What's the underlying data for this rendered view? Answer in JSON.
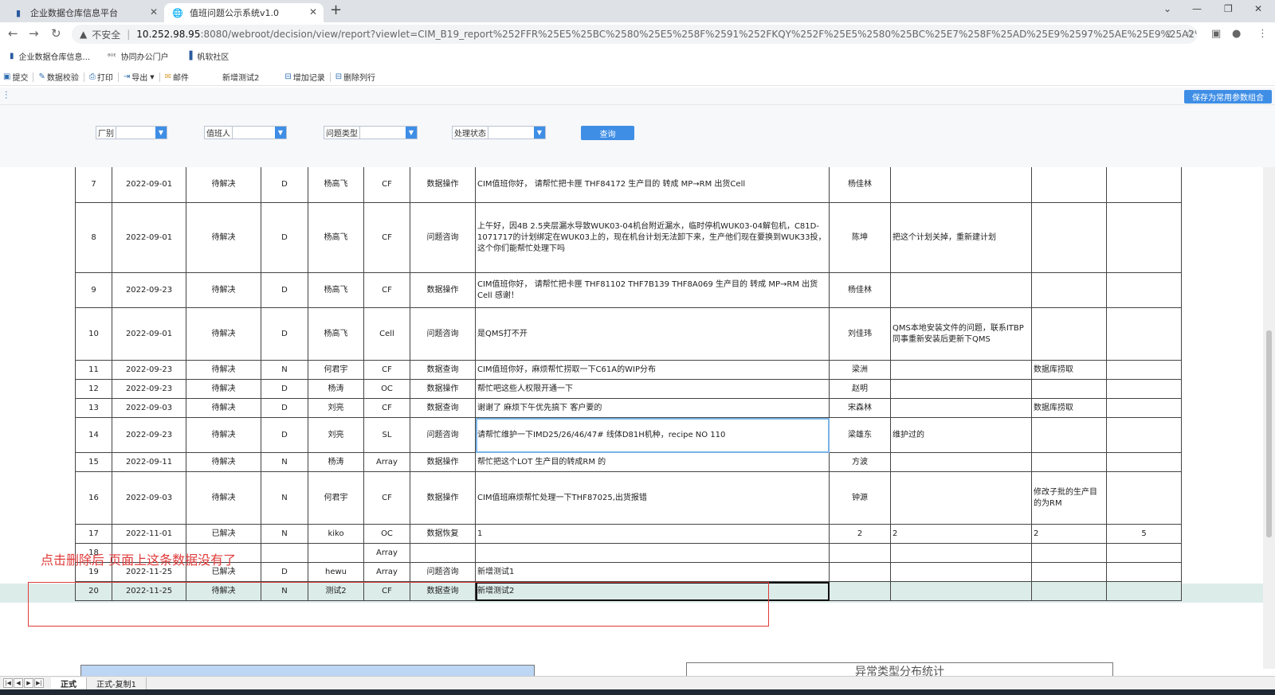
{
  "browser": {
    "tabs": [
      {
        "title": "企业数据仓库信息平台",
        "active": false
      },
      {
        "title": "值班问题公示系统v1.0",
        "active": true
      }
    ],
    "new_tab": "+",
    "address": {
      "security_label": "不安全",
      "host": "10.252.98.95",
      "path": ":8080/webroot/decision/view/report?viewlet=CIM_B19_report%252FFR%25E5%25BC%2580%25E5%258F%2591%252FKQY%252F%25E5%2580%25BC%25E7%258F%25AD%25E9%2597%25AE%25E9%25A2%2598%25..."
    },
    "bookmarks": [
      "企业数据仓库信息...",
      "协同办公门户",
      "帆软社区"
    ]
  },
  "toolbar": {
    "submit": "提交",
    "validate": "数据校验",
    "print": "打印",
    "export": "导出",
    "mail": "邮件",
    "new_test": "新增测试2",
    "add_record": "增加记录",
    "delete_row": "删除列行"
  },
  "params": {
    "save_label": "保存为常用参数组合",
    "factory_label": "厂别",
    "duty_label": "值班人",
    "type_label": "问题类型",
    "status_label": "处理状态",
    "query_label": "查询"
  },
  "rows": [
    {
      "no": "7",
      "date": "2022-09-01",
      "status": "待解决",
      "shift": "D",
      "person": "杨高飞",
      "factory": "CF",
      "type": "数据操作",
      "desc": "CIM值班你好，   请帮忙把卡匣 THF84172   生产目的 转成 MP→RM    出货Cell",
      "handler": "杨佳林",
      "solution": "",
      "note": "",
      "extra": ""
    },
    {
      "no": "8",
      "date": "2022-09-01",
      "status": "待解决",
      "shift": "D",
      "person": "杨高飞",
      "factory": "CF",
      "type": "问题咨询",
      "desc": "上午好，因4B 2.5夹层漏水导致WUK03-04机台附近漏水，临时停机WUK03-04解包机，C81D-1071717的计划绑定在WUK03上的，现在机台计划无法卸下来，生产他们现在要换到WUK33投，这个你们能帮忙处理下吗",
      "handler": "陈坤",
      "solution": "把这个计划关掉，重新建计划",
      "note": "",
      "extra": ""
    },
    {
      "no": "9",
      "date": "2022-09-23",
      "status": "待解决",
      "shift": "D",
      "person": "杨高飞",
      "factory": "CF",
      "type": "数据操作",
      "desc": "CIM值班你好，   请帮忙把卡匣 THF81102    THF7B139    THF8A069    生产目的 转成 MP→RM    出货Cell    感谢！",
      "handler": "杨佳林",
      "solution": "",
      "note": "",
      "extra": ""
    },
    {
      "no": "10",
      "date": "2022-09-01",
      "status": "待解决",
      "shift": "D",
      "person": "杨高飞",
      "factory": "Cell",
      "type": "问题咨询",
      "desc": "是QMS打不开",
      "handler": "刘佳玮",
      "solution": "QMS本地安装文件的问题，联系ITBP同事重新安装后更新下QMS",
      "note": "",
      "extra": ""
    },
    {
      "no": "11",
      "date": "2022-09-23",
      "status": "待解决",
      "shift": "N",
      "person": "何君宇",
      "factory": "CF",
      "type": "数据查询",
      "desc": "CIM值班你好，麻烦帮忙捞取一下C61A的WIP分布",
      "handler": "梁洲",
      "solution": "",
      "note": "数据库捞取",
      "extra": ""
    },
    {
      "no": "12",
      "date": "2022-09-23",
      "status": "待解决",
      "shift": "D",
      "person": "杨涛",
      "factory": "OC",
      "type": "数据操作",
      "desc": "帮忙吧这些人权限开通一下",
      "handler": "赵明",
      "solution": "",
      "note": "",
      "extra": ""
    },
    {
      "no": "13",
      "date": "2022-09-03",
      "status": "待解决",
      "shift": "D",
      "person": "刘亮",
      "factory": "CF",
      "type": "数据查询",
      "desc": "谢谢了 麻烦下午优先搞下 客户要的",
      "handler": "宋森林",
      "solution": "",
      "note": "数据库捞取",
      "extra": ""
    },
    {
      "no": "14",
      "date": "2022-09-23",
      "status": "待解决",
      "shift": "D",
      "person": "刘亮",
      "factory": "SL",
      "type": "问题咨询",
      "desc": "请帮忙维护一下IMD25/26/46/47# 线体D81H机种，recipe NO    110",
      "handler": "梁雄东",
      "solution": "维护过的",
      "note": "",
      "extra": ""
    },
    {
      "no": "15",
      "date": "2022-09-11",
      "status": "待解决",
      "shift": "N",
      "person": "杨涛",
      "factory": "Array",
      "type": "数据操作",
      "desc": "帮忙把这个LOT 生产目的转成RM 的",
      "handler": "方波",
      "solution": "",
      "note": "",
      "extra": ""
    },
    {
      "no": "16",
      "date": "2022-09-03",
      "status": "待解决",
      "shift": "N",
      "person": "何君宇",
      "factory": "CF",
      "type": "数据操作",
      "desc": "CIM值班麻烦帮忙处理一下THF87025,出货报错",
      "handler": "钟源",
      "solution": "",
      "note": "修改子批的生产目的为RM",
      "extra": ""
    },
    {
      "no": "17",
      "date": "2022-11-01",
      "status": "已解决",
      "shift": "N",
      "person": "kiko",
      "factory": "OC",
      "type": "数据恢复",
      "desc": "1",
      "handler": "2",
      "solution": "2",
      "note": "2",
      "extra": "5"
    },
    {
      "no": "18",
      "date": "",
      "status": "",
      "shift": "",
      "person": "",
      "factory": "Array",
      "type": "",
      "desc": "",
      "handler": "",
      "solution": "",
      "note": "",
      "extra": ""
    },
    {
      "no": "19",
      "date": "2022-11-25",
      "status": "已解决",
      "shift": "D",
      "person": "hewu",
      "factory": "Array",
      "type": "问题咨询",
      "desc": "新增测试1",
      "handler": "",
      "solution": "",
      "note": "",
      "extra": ""
    },
    {
      "no": "20",
      "date": "2022-11-25",
      "status": "待解决",
      "shift": "N",
      "person": "测试2",
      "factory": "CF",
      "type": "数据查询",
      "desc": "新增测试2",
      "handler": "",
      "solution": "",
      "note": "",
      "extra": ""
    }
  ],
  "annotation": "点击删除后  页面上这条数据没有了",
  "bottom": {
    "chart2_title": "异常类型分布统计"
  },
  "sheets": [
    "正式",
    "正式-复制1"
  ]
}
